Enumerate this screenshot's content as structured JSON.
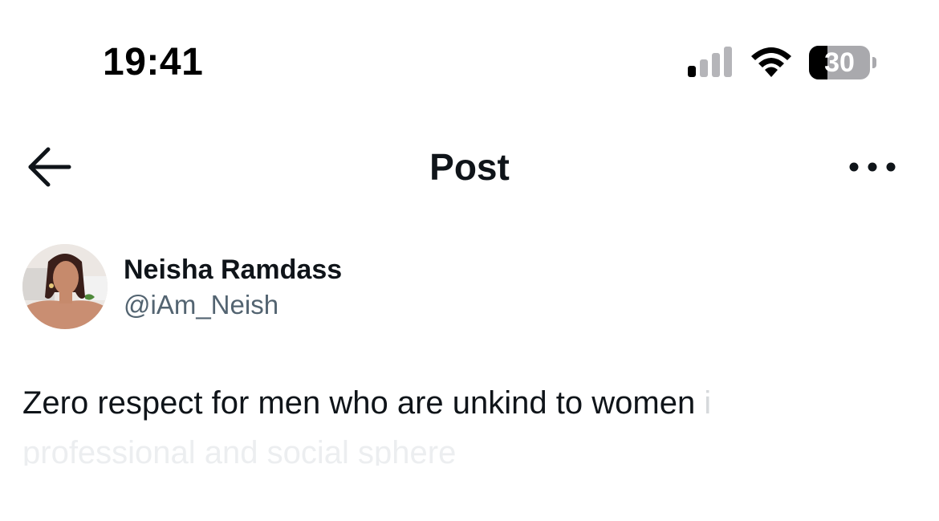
{
  "status_bar": {
    "time": "19:41",
    "signal_icon": "cellular-signal-icon",
    "wifi_icon": "wifi-icon",
    "battery_level": "30",
    "battery_fraction": 0.3
  },
  "header": {
    "back_icon": "arrow-left-icon",
    "title": "Post",
    "more_icon": "more-horizontal-icon"
  },
  "post": {
    "author_name": "Neisha Ramdass",
    "author_handle": "@iAm_Neish",
    "text_visible": "Zero respect for men who are unkind to women ",
    "text_faded": "i",
    "text_line2_faded": "professional and social sphere"
  },
  "colors": {
    "text_primary": "#0f1419",
    "text_secondary": "#536471",
    "background": "#ffffff"
  }
}
